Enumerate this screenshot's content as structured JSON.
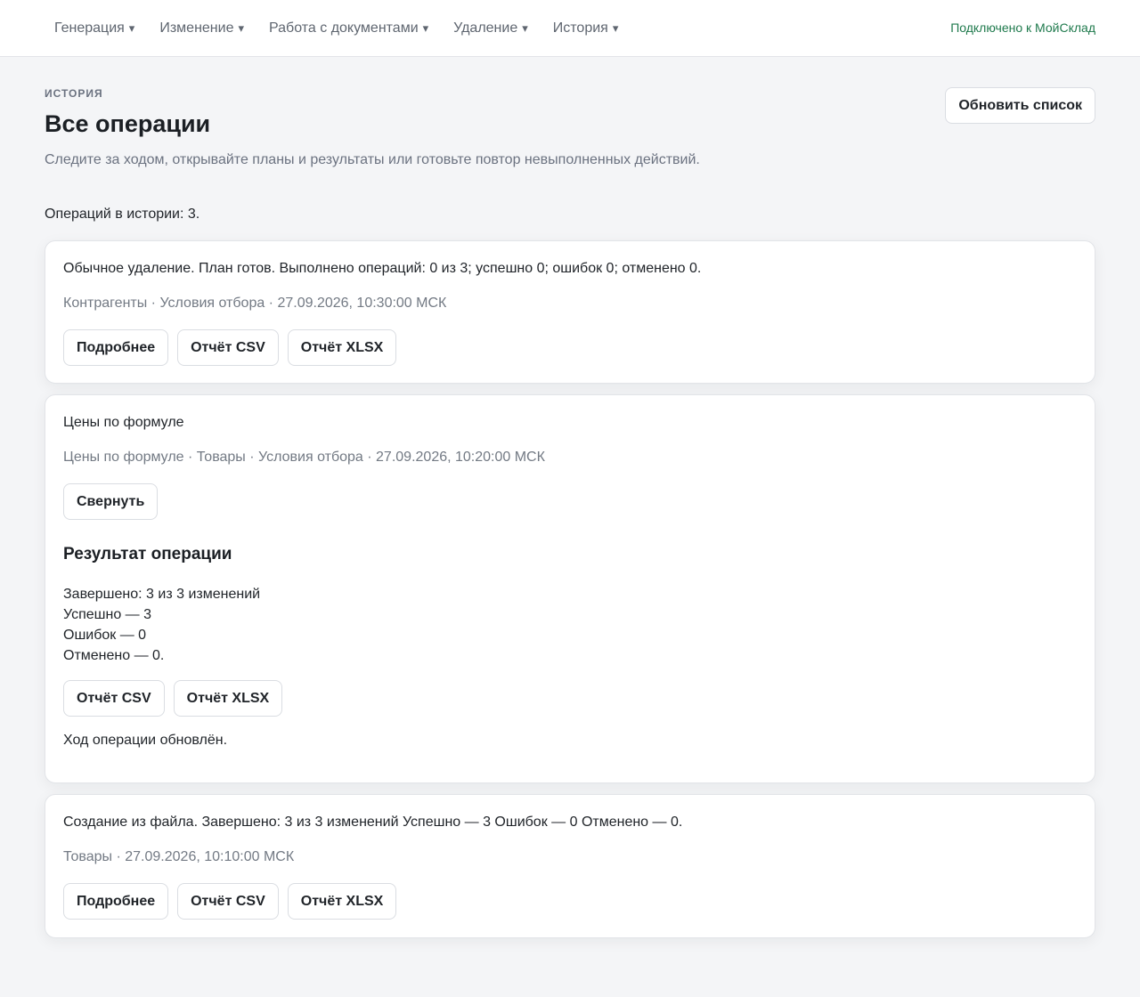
{
  "nav": {
    "items": [
      {
        "label": "Генерация",
        "caret": "▾"
      },
      {
        "label": "Изменение",
        "caret": "▾"
      },
      {
        "label": "Работа с документами",
        "caret": "▾"
      },
      {
        "label": "Удаление",
        "caret": "▾"
      },
      {
        "label": "История",
        "caret": "▾"
      }
    ],
    "connection": "Подключено к МойСклад"
  },
  "header": {
    "eyebrow": "ИСТОРИЯ",
    "title": "Все операции",
    "subtitle": "Следите за ходом, открывайте планы и результаты или готовьте повтор невыполненных действий.",
    "refresh_label": "Обновить список"
  },
  "count_text": "Операций в истории: 3.",
  "operations": [
    {
      "title": "Обычное удаление. План готов. Выполнено операций: 0 из 3; успешно 0; ошибок 0; отменено 0.",
      "meta": "Контрагенты · Условия отбора · 27.09.2026, 10:30:00 МСК",
      "buttons": [
        "Подробнее",
        "Отчёт CSV",
        "Отчёт XLSX"
      ]
    },
    {
      "title": "Цены по формуле",
      "meta": "Цены по формуле · Товары · Условия отбора · 27.09.2026, 10:20:00 МСК",
      "collapse_label": "Свернуть",
      "result": {
        "title": "Результат операции",
        "lines": [
          "Завершено: 3 из 3 изменений",
          "Успешно — 3",
          "Ошибок — 0",
          "Отменено — 0."
        ],
        "buttons": [
          "Отчёт CSV",
          "Отчёт XLSX"
        ],
        "note": "Ход операции обновлён."
      }
    },
    {
      "title": "Создание из файла. Завершено: 3 из 3 изменений Успешно — 3 Ошибок — 0 Отменено — 0.",
      "meta": "Товары · 27.09.2026, 10:10:00 МСК",
      "buttons": [
        "Подробнее",
        "Отчёт CSV",
        "Отчёт XLSX"
      ]
    }
  ],
  "colors": {
    "background": "#f4f5f7",
    "card": "#ffffff",
    "connection_text": "#1f7a4d",
    "muted_text": "#737a84",
    "border": "#dadde2"
  }
}
